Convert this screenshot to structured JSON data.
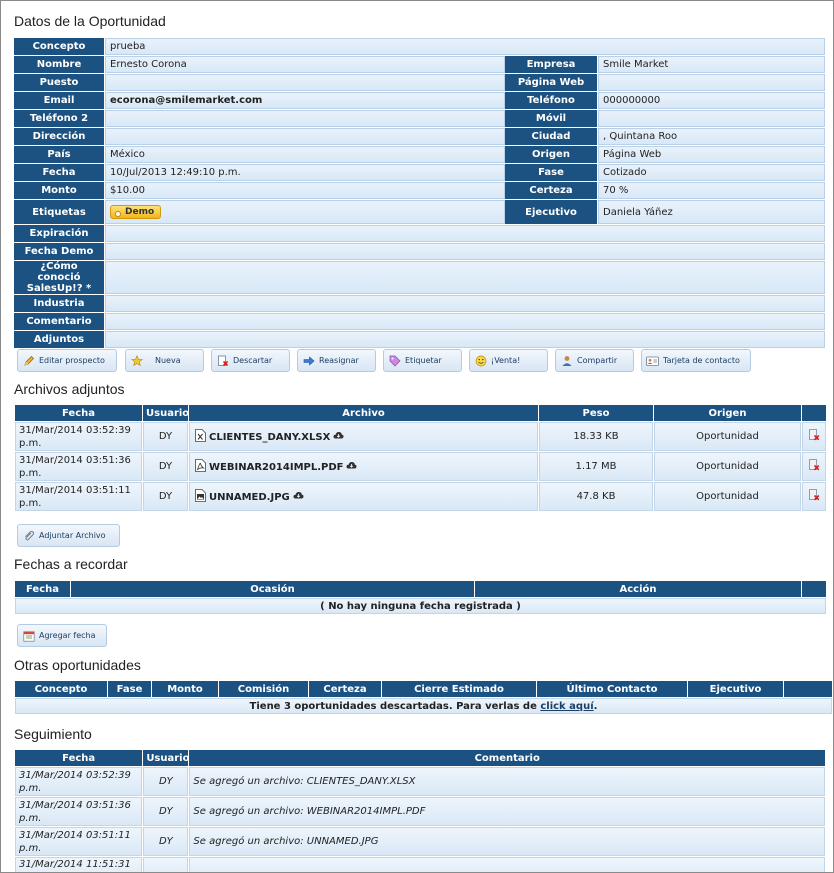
{
  "sections": {
    "datos": "Datos de la Oportunidad",
    "archivos": "Archivos adjuntos",
    "fechas": "Fechas a recordar",
    "otras": "Otras oportunidades",
    "seguimiento": "Seguimiento"
  },
  "info": {
    "concepto": {
      "label": "Concepto",
      "value": "prueba"
    },
    "nombre": {
      "label": "Nombre",
      "value": "Ernesto Corona"
    },
    "empresa": {
      "label": "Empresa",
      "value": "Smile Market"
    },
    "puesto": {
      "label": "Puesto",
      "value": ""
    },
    "pagina_web": {
      "label": "Página Web",
      "value": ""
    },
    "email": {
      "label": "Email",
      "value": "ecorona@smilemarket.com"
    },
    "telefono": {
      "label": "Teléfono",
      "value": "000000000"
    },
    "telefono2": {
      "label": "Teléfono 2",
      "value": ""
    },
    "movil": {
      "label": "Móvil",
      "value": ""
    },
    "direccion": {
      "label": "Dirección",
      "value": ""
    },
    "ciudad": {
      "label": "Ciudad",
      "value": ", Quintana Roo"
    },
    "pais": {
      "label": "País",
      "value": "México"
    },
    "origen": {
      "label": "Origen",
      "value": "Página Web"
    },
    "fecha": {
      "label": "Fecha",
      "value": "10/Jul/2013 12:49:10 p.m."
    },
    "fase": {
      "label": "Fase",
      "value": "Cotizado"
    },
    "monto": {
      "label": "Monto",
      "value": "$10.00"
    },
    "certeza": {
      "label": "Certeza",
      "value": "70 %"
    },
    "etiquetas": {
      "label": "Etiquetas",
      "tag": "Demo"
    },
    "ejecutivo": {
      "label": "Ejecutivo",
      "value": "Daniela Yáñez"
    },
    "expiracion": {
      "label": "Expiración",
      "value": ""
    },
    "fecha_demo": {
      "label": "Fecha Demo",
      "value": ""
    },
    "como_conocio": {
      "label": "¿Cómo conoció SalesUp!? *",
      "value": ""
    },
    "industria": {
      "label": "Industria",
      "value": ""
    },
    "comentario": {
      "label": "Comentario",
      "value": ""
    },
    "adjuntos": {
      "label": "Adjuntos",
      "value": ""
    }
  },
  "actions": {
    "editar": "Editar prospecto",
    "nueva": "Nueva",
    "descartar": "Descartar",
    "reasignar": "Reasignar",
    "etiquetar": "Etiquetar",
    "venta": "¡Venta!",
    "compartir": "Compartir",
    "tarjeta": "Tarjeta de contacto",
    "adjuntar": "Adjuntar Archivo",
    "agregar_fecha": "Agregar fecha"
  },
  "files": {
    "headers": {
      "fecha": "Fecha",
      "usuario": "Usuario",
      "archivo": "Archivo",
      "peso": "Peso",
      "origen": "Origen"
    },
    "rows": [
      {
        "fecha": "31/Mar/2014 03:52:39 p.m.",
        "usuario": "DY",
        "archivo": "CLIENTES_DANY.XLSX",
        "type": "xlsx-file-icon",
        "peso": "18.33 KB",
        "origen": "Oportunidad"
      },
      {
        "fecha": "31/Mar/2014 03:51:36 p.m.",
        "usuario": "DY",
        "archivo": "WEBINAR2014IMPL.PDF",
        "type": "pdf-file-icon",
        "peso": "1.17 MB",
        "origen": "Oportunidad"
      },
      {
        "fecha": "31/Mar/2014 03:51:11 p.m.",
        "usuario": "DY",
        "archivo": "UNNAMED.JPG",
        "type": "image-file-icon",
        "peso": "47.8 KB",
        "origen": "Oportunidad"
      }
    ]
  },
  "dates": {
    "headers": {
      "fecha": "Fecha",
      "ocasion": "Ocasión",
      "accion": "Acción"
    },
    "empty": "( No hay ninguna fecha registrada )"
  },
  "others": {
    "headers": {
      "concepto": "Concepto",
      "fase": "Fase",
      "monto": "Monto",
      "comision": "Comisión",
      "certeza": "Certeza",
      "cierre": "Cierre Estimado",
      "ultimo": "Último Contacto",
      "ejecutivo": "Ejecutivo"
    },
    "message": "Tiene 3 oportunidades descartadas. Para verlas de ",
    "link": "click aquí",
    "suffix": "."
  },
  "tracking": {
    "headers": {
      "fecha": "Fecha",
      "usuario": "Usuario",
      "comentario": "Comentario"
    },
    "rows": [
      {
        "fecha": "31/Mar/2014 03:52:39 p.m.",
        "usuario": "DY",
        "comentario": "Se agregó un archivo: CLIENTES_DANY.XLSX"
      },
      {
        "fecha": "31/Mar/2014 03:51:36 p.m.",
        "usuario": "DY",
        "comentario": "Se agregó un archivo: WEBINAR2014IMPL.PDF"
      },
      {
        "fecha": "31/Mar/2014 03:51:11 p.m.",
        "usuario": "DY",
        "comentario": "Se agregó un archivo: UNNAMED.JPG"
      },
      {
        "fecha": "31/Mar/2014 11:51:31",
        "usuario": "",
        "comentario": ""
      }
    ]
  }
}
